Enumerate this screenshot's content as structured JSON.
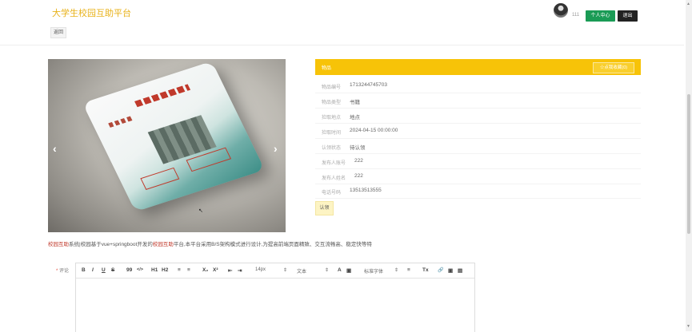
{
  "header": {
    "site_title": "大学生校园互助平台",
    "back_label": "返回",
    "username": "111",
    "profile_button": "个人中心",
    "logout_button": "退出"
  },
  "item": {
    "panel_title": "物品",
    "favorite_button": "☆点我收藏(0)",
    "fields": [
      {
        "label": "物品编号",
        "value": "1713244745703"
      },
      {
        "label": "物品类型",
        "value": "书籍"
      },
      {
        "label": "捡取地点",
        "value": "地点"
      },
      {
        "label": "捡取时间",
        "value": "2024-04-15 00:00:00"
      },
      {
        "label": "认领状态",
        "value": "待认领"
      },
      {
        "label": "发布人账号",
        "value": "222"
      },
      {
        "label": "发布人姓名",
        "value": "222"
      },
      {
        "label": "电话号码",
        "value": "13513513555"
      }
    ],
    "claim_button": "认领"
  },
  "description": {
    "part1": "校园互助",
    "part2": "系统|校园基于vue+springboot开发的",
    "part3": "校园互助",
    "part4": "平台,本平台采用B/S架构模式进行设计,为提高前端页面精致、交互流畅高、稳定快等特"
  },
  "comment": {
    "star": "*",
    "label": "评论",
    "toolbar": {
      "bold": "B",
      "italic": "I",
      "underline": "U",
      "strike": "S",
      "quote": "99",
      "code": "</>",
      "h1": "H1",
      "h2": "H2",
      "ordered": "≡",
      "bullet": "≡",
      "sub": "X₂",
      "sup": "X²",
      "outdent": "⇤",
      "indent": "⇥",
      "size": "14px",
      "text": "文本",
      "color": "A",
      "bg": "▣",
      "font": "标准字体",
      "align": "≡",
      "clean": "Tx",
      "link": "🔗",
      "image": "▣",
      "video": "▤"
    }
  },
  "carousel": {
    "prev": "‹",
    "next": "›"
  },
  "colors": {
    "accent": "#f7c308",
    "title": "#e8b21a",
    "primary_button": "#1a9b55",
    "dark_button": "#222222"
  }
}
